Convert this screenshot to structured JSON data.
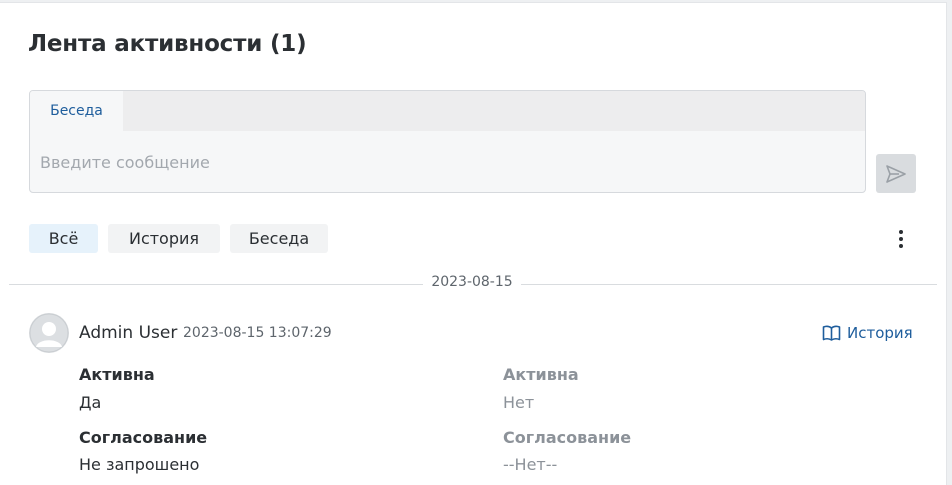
{
  "activity": {
    "title": "Лента активности (1)",
    "composer": {
      "tab_label": "Беседа",
      "placeholder": "Введите сообщение",
      "send_icon": "send-icon"
    },
    "filters": [
      {
        "label": "Всё",
        "active": true
      },
      {
        "label": "История",
        "active": false
      },
      {
        "label": "Беседа",
        "active": false
      }
    ],
    "more_icon": "more-vertical-icon",
    "date_separator": "2023-08-15",
    "entry": {
      "author": "Admin User",
      "timestamp": "2023-08-15 13:07:29",
      "history_link": "История",
      "history_icon": "book-icon",
      "changes": [
        {
          "field": "Активна",
          "new_value": "Да",
          "old_value": "Нет"
        },
        {
          "field": "Согласование",
          "new_value": "Не запрошено",
          "old_value": "--Нет--"
        }
      ]
    }
  },
  "colors": {
    "accent": "#1e5d9c",
    "active_filter_bg": "#e6f2fb",
    "muted_text": "#8c9299"
  }
}
